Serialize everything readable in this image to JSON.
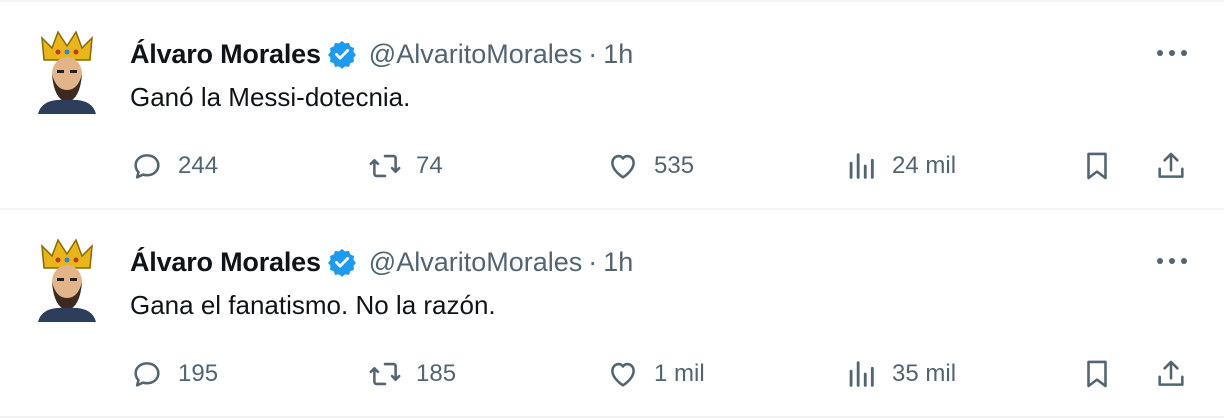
{
  "tweets": [
    {
      "name": "Álvaro Morales",
      "handle": "@AlvaritoMorales",
      "separator": "·",
      "time": "1h",
      "text": "Ganó la Messi-dotecnia.",
      "replies": "244",
      "retweets": "74",
      "likes": "535",
      "views": "24 mil"
    },
    {
      "name": "Álvaro Morales",
      "handle": "@AlvaritoMorales",
      "separator": "·",
      "time": "1h",
      "text": "Gana el fanatismo. No la razón.",
      "replies": "195",
      "retweets": "185",
      "likes": "1 mil",
      "views": "35 mil"
    }
  ],
  "colors": {
    "text_primary": "#0f1419",
    "text_secondary": "#536471",
    "verified": "#1d9bf0",
    "divider": "#eff3f4"
  },
  "icons": [
    "verified-badge-icon",
    "more-icon",
    "reply-icon",
    "retweet-icon",
    "like-icon",
    "views-icon",
    "bookmark-icon",
    "share-icon"
  ]
}
